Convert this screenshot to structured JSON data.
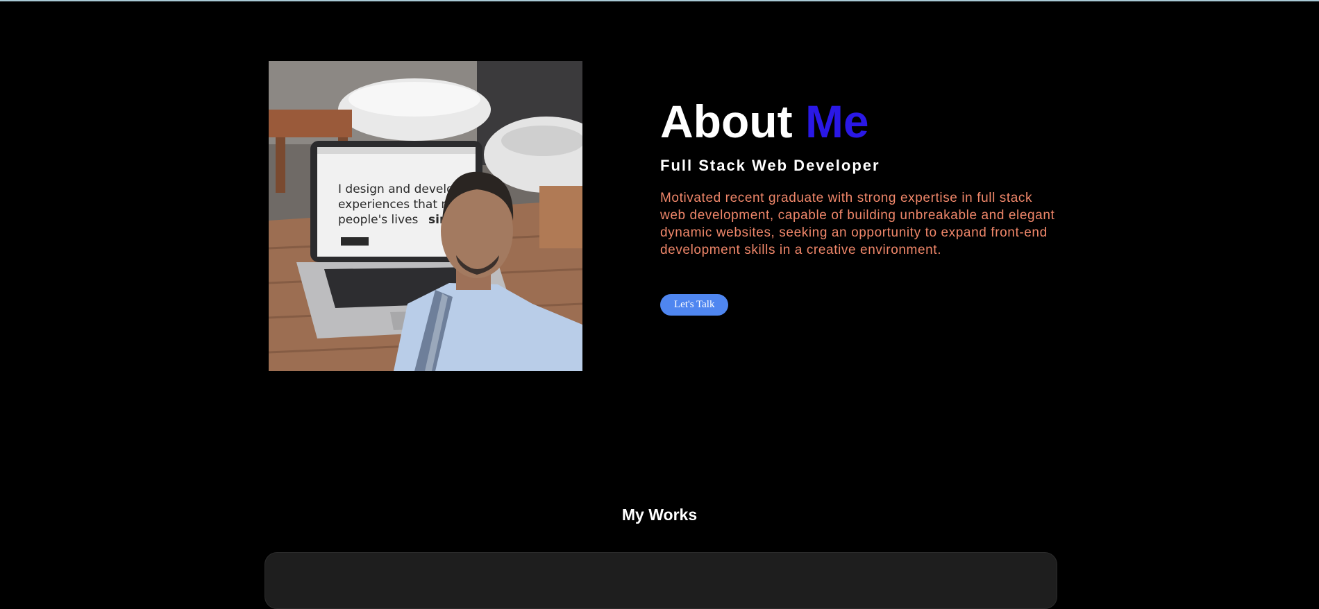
{
  "about": {
    "heading_main": "About ",
    "heading_accent": "Me",
    "subtitle": "Full Stack Web Developer",
    "bio": "Motivated recent graduate with strong expertise in full stack web development, capable of building unbreakable and elegant dynamic websites, seeking an opportunity to expand front-end development skills in a creative environment.",
    "cta_label": "Let's Talk"
  },
  "photo": {
    "screen_line1": "I design and develop",
    "screen_line2": "experiences that make",
    "screen_line3": "people's lives",
    "screen_emphasis": "simple."
  },
  "works": {
    "title": "My Works"
  },
  "colors": {
    "background": "#000000",
    "accent": "#2a18e6",
    "bio_text": "#f0876a",
    "button": "#4f86f0",
    "card": "#1e1e1e"
  }
}
